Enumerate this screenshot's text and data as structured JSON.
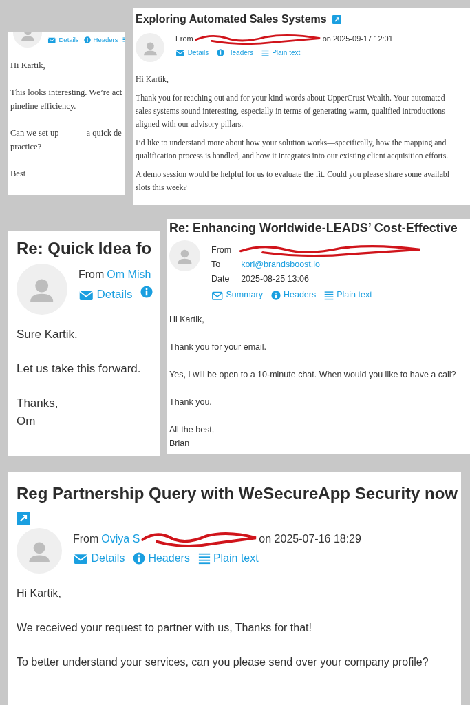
{
  "cards": [
    {
      "kind": "serif",
      "header": {
        "kind": "none"
      },
      "actions": [
        {
          "kind": "envelope",
          "label": "Details"
        },
        {
          "kind": "info",
          "label": "Headers"
        },
        {
          "kind": "list"
        }
      ],
      "paragraphs": [
        [
          "Hi Kartik,"
        ],
        [
          "This looks interesting. We’re act",
          "pineline efficiency."
        ],
        [
          "Can we set up",
          "a quick de",
          "practice?"
        ],
        [
          "Best"
        ]
      ]
    },
    {
      "kind": "serif",
      "title": "Exploring Automated Sales Systems",
      "link_icon": true,
      "header": {
        "kind": "inline",
        "label": "From",
        "sender": {
          "redacted": true
        },
        "date": "on 2025-09-17 12:01"
      },
      "actions": [
        {
          "kind": "envelope",
          "label": "Details"
        },
        {
          "kind": "info",
          "label": "Headers"
        },
        {
          "kind": "list",
          "label": "Plain text"
        }
      ],
      "paragraphs": [
        [
          "Hi Kartik,"
        ],
        [
          "Thank you for reaching out and for your kind words about UpperCrust Wealth. Your automated",
          "sales systems sound interesting, especially in terms of generating warm, qualified introductions",
          "aligned with our advisory pillars."
        ],
        [
          "I’d like to understand more about how your solution works—specifically, how the mapping and",
          "qualification process is handled, and how it integrates into our existing client acquisition efforts."
        ],
        [
          "A demo session would be helpful for us to evaluate the fit. Could you please share some availabl",
          "slots this week?"
        ]
      ]
    },
    {
      "kind": "sans",
      "title": "Re: Quick Idea fo",
      "header": {
        "kind": "inline",
        "label": "From",
        "sender": {
          "name": "Om Mish"
        }
      },
      "actions": [
        {
          "kind": "envelope",
          "label": "Details"
        },
        {
          "kind": "info"
        }
      ],
      "paragraphs": [
        [
          "Sure Kartik."
        ],
        [
          "Let us take this forward."
        ],
        [
          "Thanks,",
          "Om"
        ]
      ]
    },
    {
      "kind": "sans",
      "title": "Re: Enhancing Worldwide-LEADS’ Cost-Effective",
      "header": {
        "kind": "table",
        "rows": [
          {
            "label": "From",
            "redacted": true
          },
          {
            "label": "To",
            "value": "kori@brandsboost.io",
            "link": true
          },
          {
            "label": "Date",
            "value": "2025-08-25 13:06",
            "link": false
          }
        ]
      },
      "actions": [
        {
          "kind": "envelope-outline",
          "label": "Summary"
        },
        {
          "kind": "info",
          "label": "Headers"
        },
        {
          "kind": "list",
          "label": "Plain text"
        }
      ],
      "paragraphs": [
        [
          "Hi Kartik,"
        ],
        [
          "Thank you for your email."
        ],
        [
          "Yes, I will be open to a 10-minute chat. When would you like to have a call?"
        ],
        [
          "Thank you."
        ],
        [
          "All the best,",
          "Brian"
        ]
      ]
    },
    {
      "kind": "sans",
      "title": "Reg Partnership Query with WeSecureApp Security now",
      "link_icon": true,
      "header": {
        "kind": "inline",
        "label": "From",
        "sender": {
          "name": "Oviya S",
          "redacted": true
        },
        "date": "on 2025-07-16 18:29"
      },
      "actions": [
        {
          "kind": "envelope",
          "label": "Details"
        },
        {
          "kind": "info",
          "label": "Headers"
        },
        {
          "kind": "list",
          "label": "Plain text"
        }
      ],
      "paragraphs": [
        [
          "Hi Kartik,"
        ],
        [
          "We received your request to partner with us, Thanks for that!"
        ],
        [
          "To better understand your services, can you please send over your company profile?"
        ]
      ]
    }
  ]
}
